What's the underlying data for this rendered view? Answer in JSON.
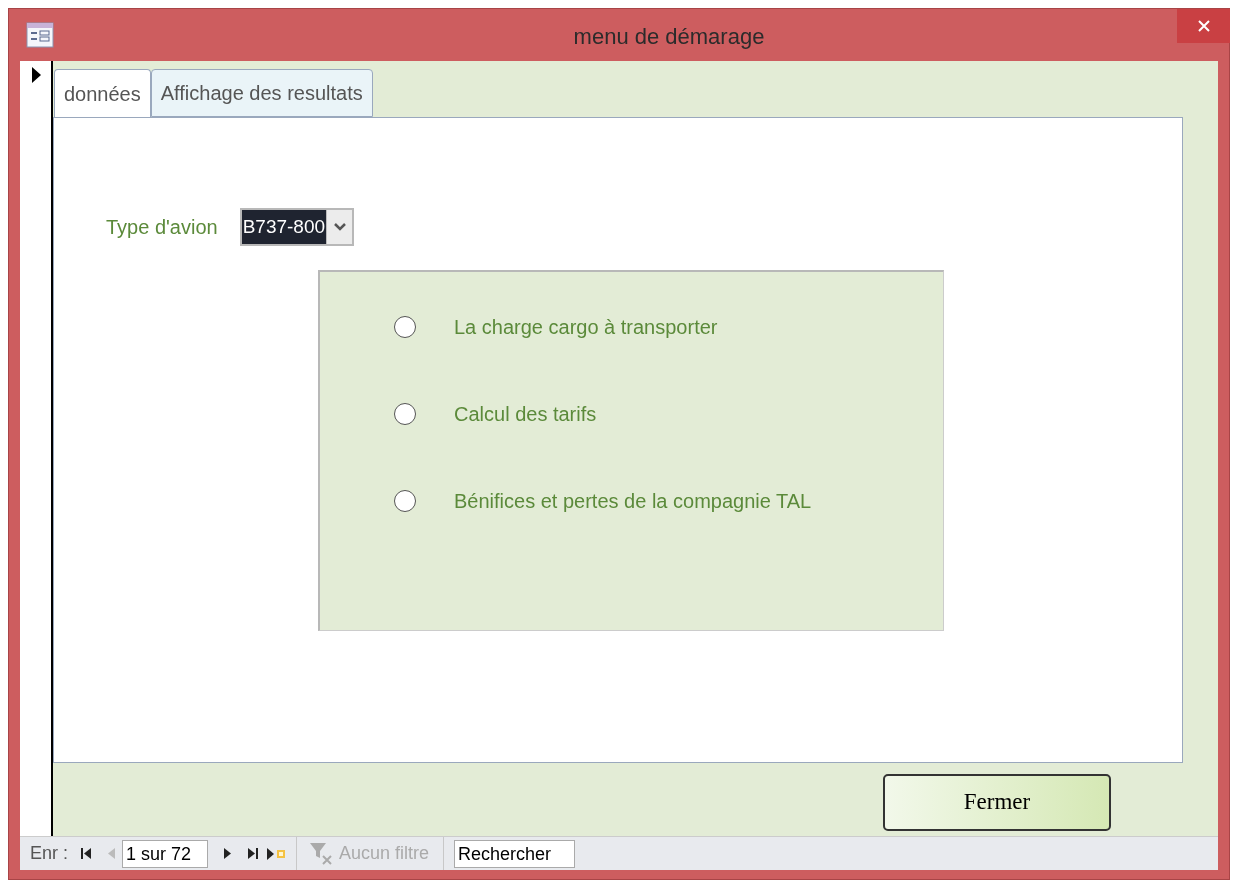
{
  "window": {
    "title": "menu de démarage"
  },
  "tabs": [
    {
      "label": "données",
      "selected": true
    },
    {
      "label": "Affichage des resultats",
      "selected": false
    }
  ],
  "aircraft_type": {
    "label": "Type d'avion",
    "value": "B737-800",
    "highlighted": true
  },
  "options": [
    {
      "label": "La charge cargo à transporter",
      "selected": false
    },
    {
      "label": "Calcul des tarifs",
      "selected": false
    },
    {
      "label": "Bénifices et pertes de la compagnie TAL",
      "selected": false
    }
  ],
  "close_button": "Fermer",
  "navigation": {
    "label": "Enr :",
    "record": "1 sur 72",
    "previous_disabled": true,
    "filter": {
      "label": "Aucun filtre",
      "disabled": true
    },
    "search": "Rechercher"
  }
}
